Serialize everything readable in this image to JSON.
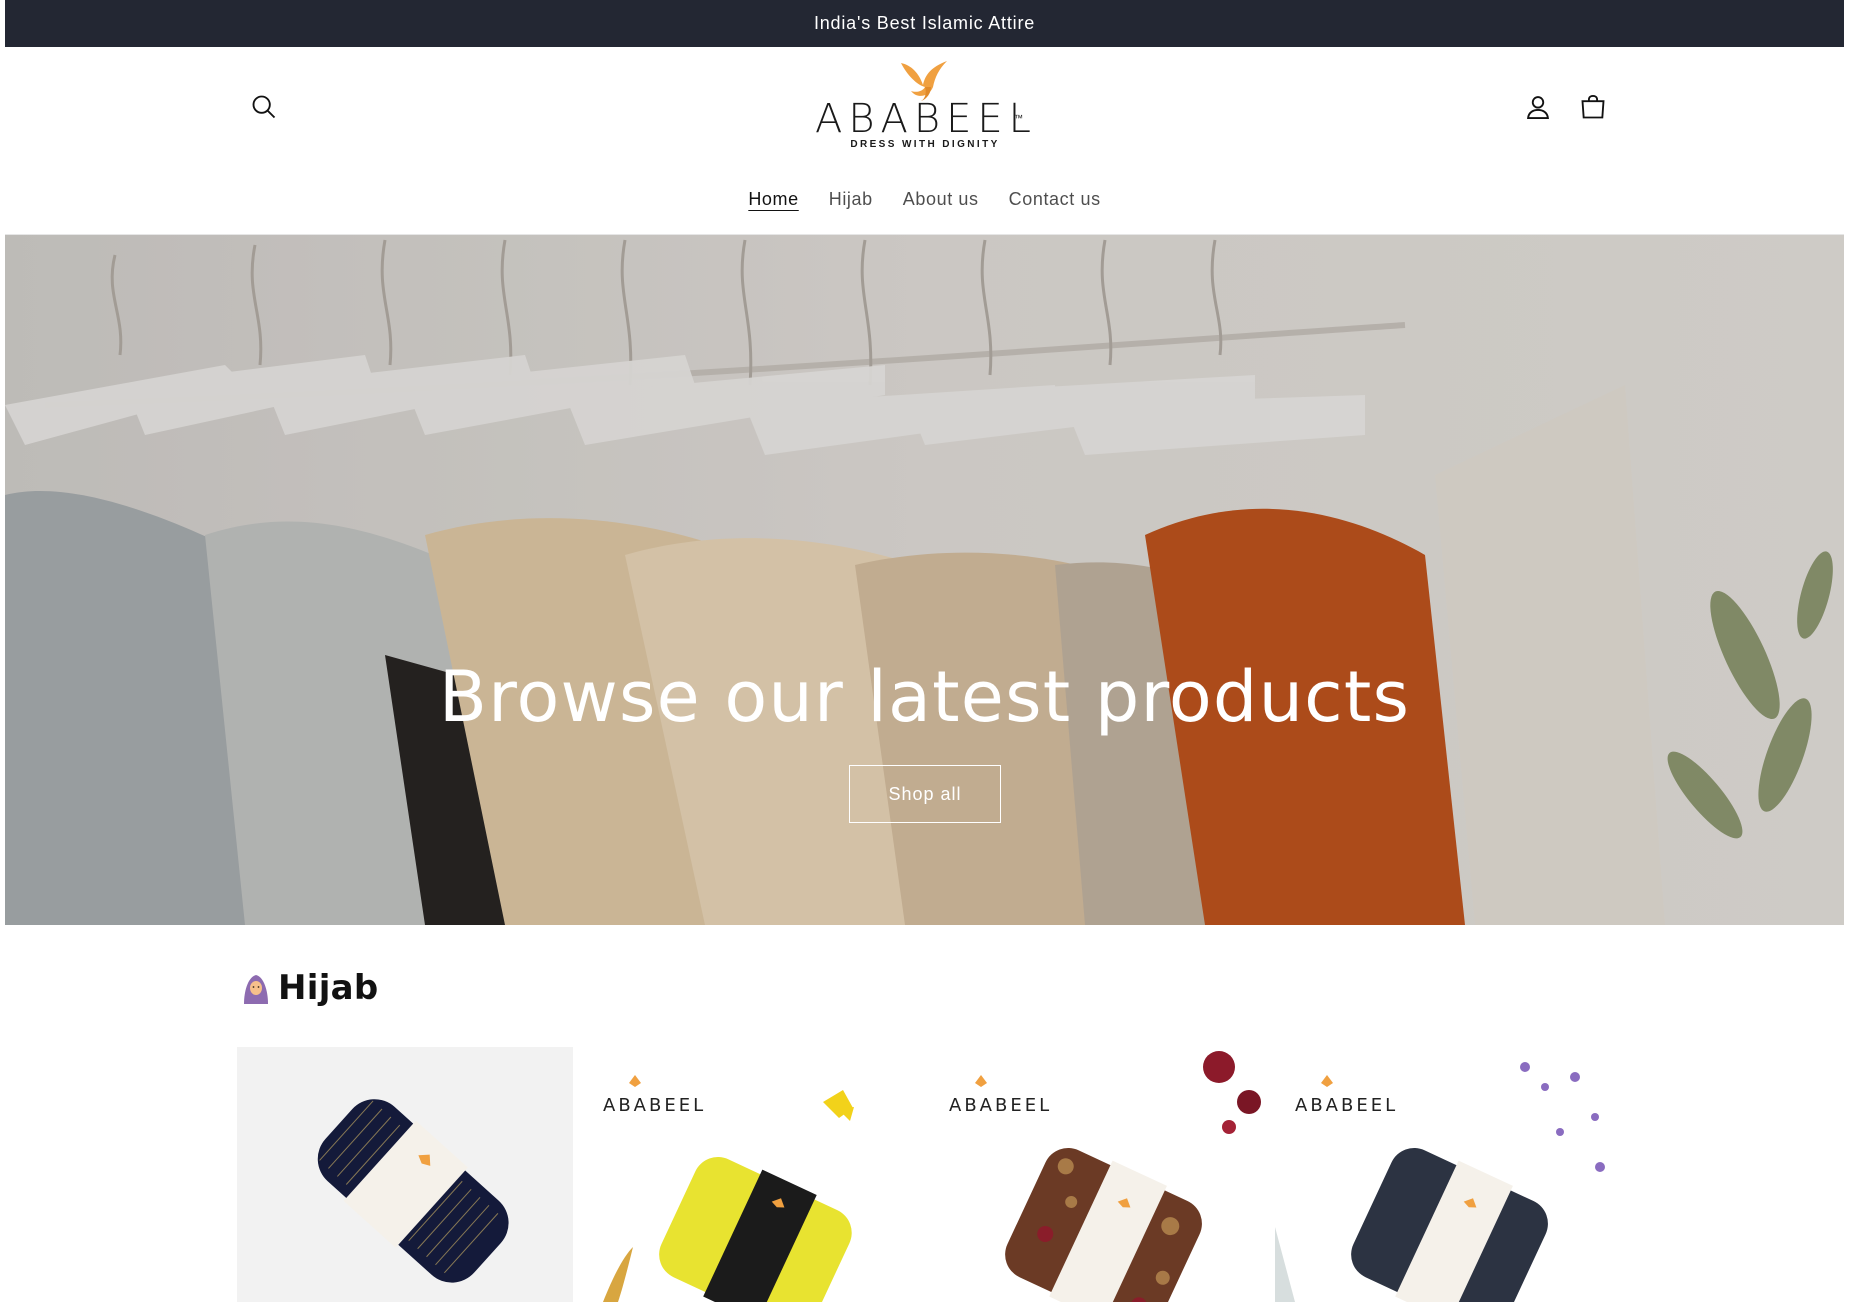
{
  "announcement": {
    "text": "India's Best Islamic Attire"
  },
  "header": {
    "logo": {
      "wordmark": "ABABEEL",
      "trademark": "™",
      "tagline": "DRESS WITH DIGNITY"
    },
    "icons": {
      "search": "search-icon",
      "account": "account-icon",
      "cart": "cart-icon"
    },
    "nav": [
      {
        "label": "Home",
        "active": true
      },
      {
        "label": "Hijab",
        "active": false
      },
      {
        "label": "About us",
        "active": false
      },
      {
        "label": "Contact us",
        "active": false
      }
    ]
  },
  "hero": {
    "title": "Browse our latest products",
    "button_label": "Shop all"
  },
  "collection": {
    "emoji": "woman-with-headscarf-emoji",
    "title": "Hijab",
    "products": [
      {
        "brand": "",
        "style": "navy-striped-hijab"
      },
      {
        "brand": "ABABEEL",
        "style": "yellow-hijab"
      },
      {
        "brand": "ABABEEL",
        "style": "floral-print-hijab"
      },
      {
        "brand": "ABABEEL",
        "style": "charcoal-hijab"
      }
    ]
  },
  "colors": {
    "announcement_bg": "#232733",
    "logo_accent": "#f0a040",
    "text": "#121212"
  }
}
